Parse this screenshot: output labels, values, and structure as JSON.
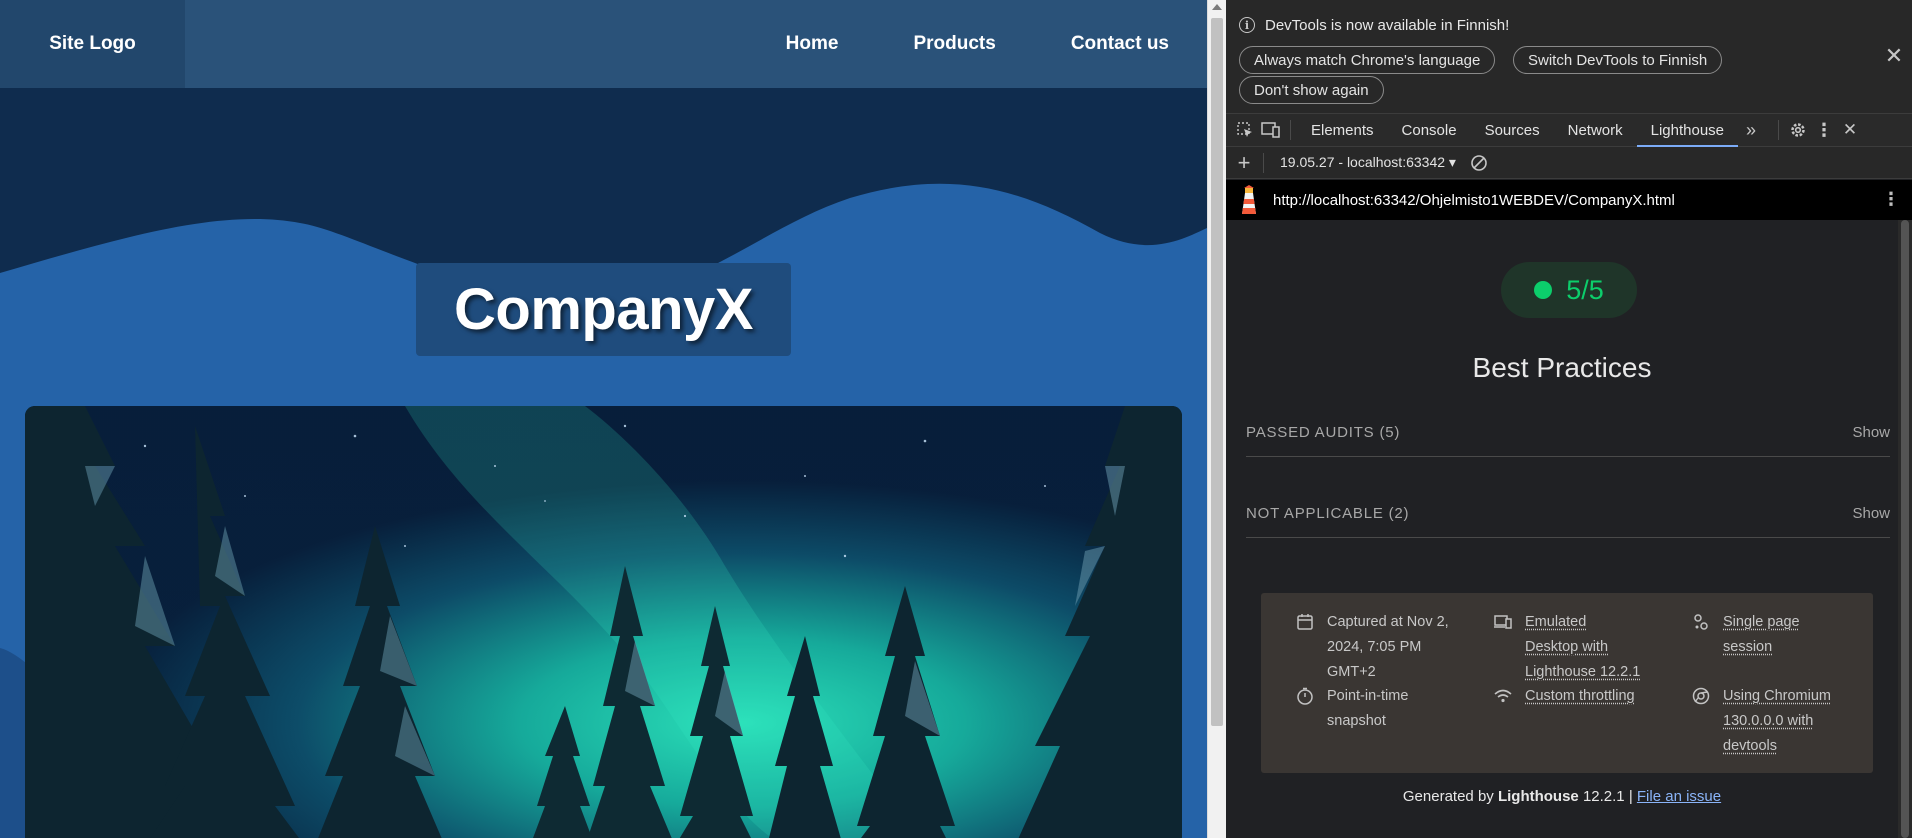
{
  "site": {
    "logo": "Site Logo",
    "nav": [
      "Home",
      "Products",
      "Contact us"
    ],
    "hero_title": "CompanyX"
  },
  "devtools": {
    "notice": {
      "text": "DevTools is now available in Finnish!",
      "buttons": [
        "Always match Chrome's language",
        "Switch DevTools to Finnish",
        "Don't show again"
      ]
    },
    "tabs": [
      "Elements",
      "Console",
      "Sources",
      "Network",
      "Lighthouse"
    ],
    "active_tab": "Lighthouse",
    "toolbar": {
      "report_select": "19.05.27 - localhost:63342 ▾"
    },
    "url": "http://localhost:63342/Ohjelmisto1WEBDEV/CompanyX.html",
    "score": "5/5",
    "category": "Best Practices",
    "groups": [
      {
        "label": "PASSED AUDITS (5)",
        "action": "Show"
      },
      {
        "label": "NOT APPLICABLE (2)",
        "action": "Show"
      }
    ],
    "meta": {
      "captured": "Captured at Nov 2, 2024, 7:05 PM GMT+2",
      "snapshot": "Point-in-time snapshot",
      "device": "Emulated Desktop with Lighthouse 12.2.1",
      "throttling": "Custom throttling",
      "session": "Single page session",
      "browser": "Using Chromium 130.0.0.0 with devtools"
    },
    "footer": {
      "prefix": "Generated by ",
      "brand": "Lighthouse",
      "version": " 12.2.1 | ",
      "link": "File an issue"
    }
  },
  "colors": {
    "site_bg_dark": "#0f2c4e",
    "site_wave": "#2563a8",
    "header": "#2a5279",
    "score_green": "#0cce6b",
    "link_blue": "#8ab4f8"
  }
}
